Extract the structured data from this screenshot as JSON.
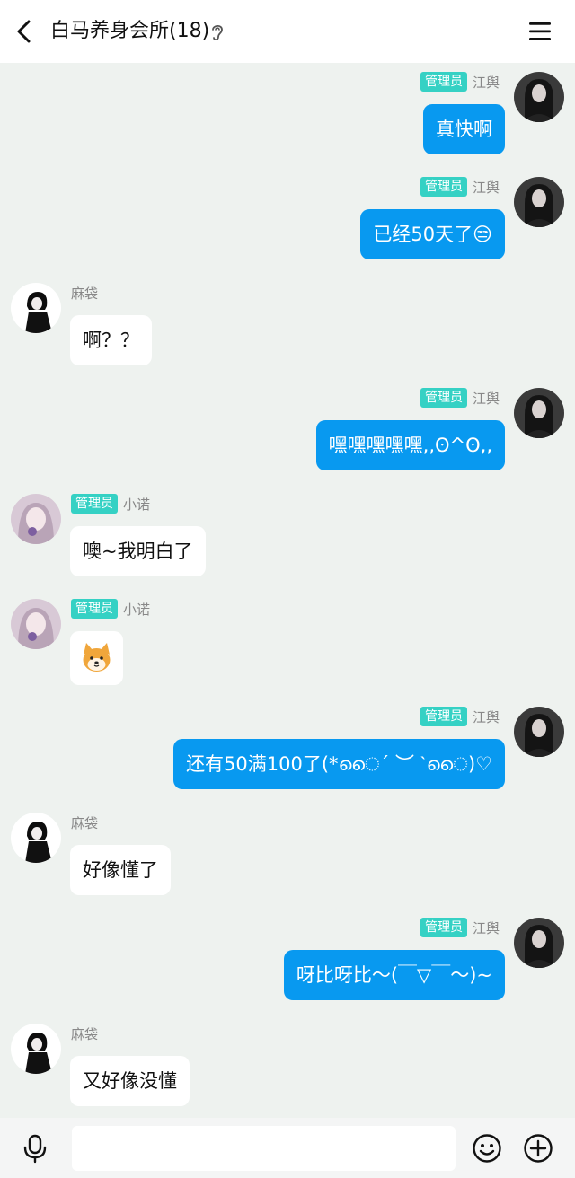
{
  "header": {
    "title": "白马养身会所(18)",
    "back_icon": "chevron-left-icon",
    "mode_icon": "ear-icon",
    "menu_icon": "hamburger-menu-icon"
  },
  "messages": [
    {
      "sender": "江舆",
      "badge": "管理员",
      "text": "真快啊",
      "outgoing": true
    },
    {
      "sender": "江舆",
      "badge": "管理员",
      "text": "已经50天了😒",
      "outgoing": true
    },
    {
      "sender": "麻袋",
      "text": "啊？？",
      "outgoing": false
    },
    {
      "sender": "江舆",
      "badge": "管理员",
      "text": "嘿嘿嘿嘿嘿,,ʘ^ʘ,,",
      "outgoing": true
    },
    {
      "sender": "小诺",
      "badge": "管理员",
      "text": "噢~我明白了",
      "outgoing": false
    },
    {
      "sender": "小诺",
      "badge": "管理员",
      "text": "",
      "sticker": "shiba-dog-emoji",
      "outgoing": false
    },
    {
      "sender": "江舆",
      "badge": "管理员",
      "text": "还有50满100了(*ൈ´ ︶ `ൈ)♡",
      "outgoing": true
    },
    {
      "sender": "麻袋",
      "text": "好像懂了",
      "outgoing": false
    },
    {
      "sender": "江舆",
      "badge": "管理员",
      "text": "呀比呀比～(￣▽￣～)~",
      "outgoing": true
    },
    {
      "sender": "麻袋",
      "text": "又好像没懂",
      "outgoing": false
    }
  ],
  "input_bar": {
    "placeholder": "",
    "mic_icon": "microphone-icon",
    "emoji_icon": "smiley-icon",
    "plus_icon": "plus-circle-icon"
  },
  "colors": {
    "chat_background": "#eef2ef",
    "outgoing_bubble": "#0899f0",
    "incoming_bubble": "#ffffff",
    "admin_badge": "#35d1c4"
  }
}
